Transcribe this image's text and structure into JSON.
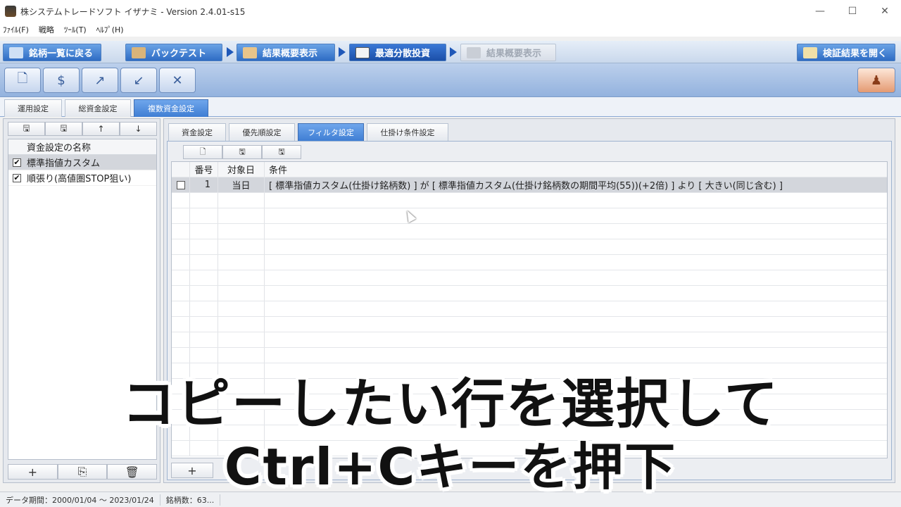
{
  "window": {
    "title": "株システムトレードソフト イザナミ - Version 2.4.01-s15",
    "controls": {
      "minimize": "—",
      "maximize": "☐",
      "close": "✕"
    }
  },
  "menu": [
    "ﾌｧｲﾙ(F)",
    "戦略",
    "ﾂｰﾙ(T)",
    "ﾍﾙﾌﾟ(H)"
  ],
  "nav": {
    "back": "銘柄一覧に戻る",
    "backtest": "バックテスト",
    "summary1": "結果概要表示",
    "optimal": "最適分散投資",
    "summary2": "結果概要表示",
    "open_results": "検証結果を開く"
  },
  "toolbar_icons": [
    "new-file-icon",
    "money-icon",
    "export-icon",
    "import-icon",
    "tools-icon",
    "stamp-icon"
  ],
  "top_tabs": [
    {
      "label": "運用設定",
      "active": false
    },
    {
      "label": "総資金設定",
      "active": false
    },
    {
      "label": "複数資金設定",
      "active": true
    }
  ],
  "left_panel": {
    "header": "資金設定の名称",
    "items": [
      {
        "label": "標準指値カスタム",
        "checked": true,
        "selected": true
      },
      {
        "label": "順張り(高値圏STOP狙い)",
        "checked": true,
        "selected": false
      }
    ],
    "toolbar": [
      "🖫",
      "🖫",
      "↑",
      "↓"
    ],
    "footer": [
      "+",
      "⎘",
      "🗑"
    ]
  },
  "sub_tabs": [
    {
      "label": "資金設定",
      "active": false
    },
    {
      "label": "優先順設定",
      "active": false
    },
    {
      "label": "フィルタ設定",
      "active": true
    },
    {
      "label": "仕掛け条件設定",
      "active": false
    }
  ],
  "grid": {
    "toolbar": [
      "🗋",
      "🖫",
      "🖫"
    ],
    "columns": {
      "number": "番号",
      "target": "対象日",
      "condition": "条件"
    },
    "rows": [
      {
        "checked": false,
        "number": "1",
        "target": "当日",
        "condition": "[ 標準指値カスタム(仕掛け銘柄数) ] が [ 標準指値カスタム(仕掛け銘柄数の期間平均(55))(+2倍) ] より [ 大きい(同じ含む) ]"
      }
    ],
    "footer_add": "+"
  },
  "status": {
    "period": "データ期間：2000/01/04 〜 2023/01/24",
    "count": "銘柄数：63..."
  },
  "caption": {
    "line1": "コピーしたい行を選択して",
    "line2": "Ctrl+Cキーを押下"
  }
}
